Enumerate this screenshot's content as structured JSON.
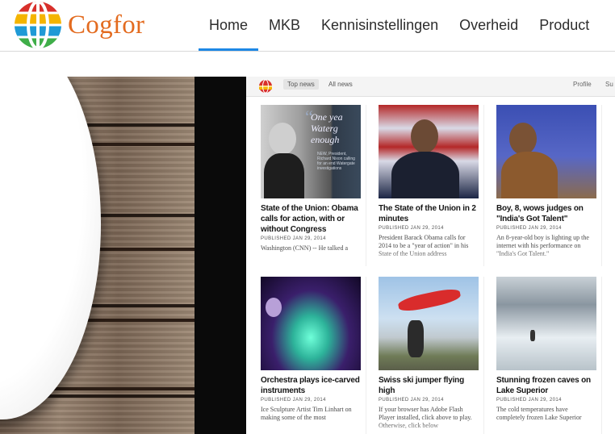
{
  "brand": {
    "name": "Cogfor",
    "logo_icon": "globe-logo-icon"
  },
  "nav": {
    "items": [
      {
        "label": "Home",
        "active": true
      },
      {
        "label": "MKB",
        "active": false
      },
      {
        "label": "Kennisinstellingen",
        "active": false
      },
      {
        "label": "Overheid",
        "active": false
      },
      {
        "label": "Product",
        "active": false
      }
    ]
  },
  "colors": {
    "accent": "#1e88e5",
    "brand": "#e36b1f"
  },
  "screen": {
    "tabs": [
      {
        "label": "Top news"
      },
      {
        "label": "All news"
      }
    ],
    "right": [
      {
        "label": "Profile"
      },
      {
        "label": "Su"
      }
    ],
    "cards": [
      {
        "title": "State of the Union: Obama calls for action, with or without Congress",
        "meta": "PUBLISHED JAN 29, 2014",
        "snippet": "Washington (CNN) -- He talked a",
        "image": "nixon",
        "quote": "One yea Waterg enough",
        "quote_sub": "NEW, President, Richard Nixon calling for an end Watergate investigations"
      },
      {
        "title": "The State of the Union in 2 minutes",
        "meta": "PUBLISHED JAN 29, 2014",
        "snippet": "President Barack Obama calls for 2014 to be a \"year of action\" in his State of the Union address",
        "image": "obama"
      },
      {
        "title": "Boy, 8, wows judges on \"India's Got Talent\"",
        "meta": "PUBLISHED JAN 29, 2014",
        "snippet": "An 8-year-old boy is lighting up the internet with his performance on \"India's Got Talent.\"",
        "image": "boy"
      },
      {
        "title": "Orchestra plays ice-carved instruments",
        "meta": "PUBLISHED JAN 29, 2014",
        "snippet": "Ice Sculpture Artist Tim Linhart on making some of the most",
        "image": "orchestra"
      },
      {
        "title": "Swiss ski jumper flying high",
        "meta": "PUBLISHED JAN 29, 2014",
        "snippet": "If your browser has Adobe Flash Player installed, click above to play. Otherwise, click below",
        "image": "ski"
      },
      {
        "title": "Stunning frozen caves on Lake Superior",
        "meta": "PUBLISHED JAN 29, 2014",
        "snippet": "The cold temperatures have completely frozen Lake Superior",
        "image": "ice"
      }
    ]
  }
}
